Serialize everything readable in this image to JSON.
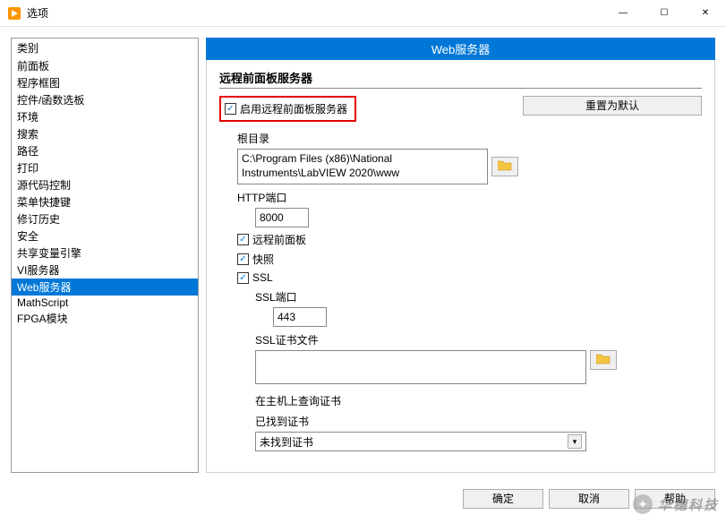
{
  "window": {
    "title": "选项",
    "minimize": "—",
    "maximize": "☐",
    "close": "✕"
  },
  "sidebar": {
    "header": "类别",
    "items": [
      {
        "label": "前面板"
      },
      {
        "label": "程序框图"
      },
      {
        "label": "控件/函数选板"
      },
      {
        "label": "环境"
      },
      {
        "label": "搜索"
      },
      {
        "label": "路径"
      },
      {
        "label": "打印"
      },
      {
        "label": "源代码控制"
      },
      {
        "label": "菜单快捷键"
      },
      {
        "label": "修订历史"
      },
      {
        "label": "安全"
      },
      {
        "label": "共享变量引擎"
      },
      {
        "label": "VI服务器"
      },
      {
        "label": "Web服务器",
        "selected": true
      },
      {
        "label": "MathScript"
      },
      {
        "label": "FPGA模块"
      }
    ]
  },
  "content": {
    "header": "Web服务器",
    "section_title": "远程前面板服务器",
    "enable_checkbox": {
      "label": "启用远程前面板服务器",
      "checked": true
    },
    "reset_button": "重置为默认",
    "root_dir": {
      "label": "根目录",
      "value": "C:\\Program Files (x86)\\National Instruments\\LabVIEW 2020\\www"
    },
    "http_port": {
      "label": "HTTP端口",
      "value": "8000"
    },
    "remote_panel": {
      "label": "远程前面板",
      "checked": true
    },
    "snapshot": {
      "label": "快照",
      "checked": true
    },
    "ssl": {
      "label": "SSL",
      "checked": true
    },
    "ssl_port": {
      "label": "SSL端口",
      "value": "443"
    },
    "ssl_cert_file": {
      "label": "SSL证书文件",
      "value": ""
    },
    "query_cert": {
      "label": "在主机上查询证书"
    },
    "found_cert": {
      "label": "已找到证书",
      "value": "未找到证书"
    }
  },
  "footer": {
    "ok": "确定",
    "cancel": "取消",
    "help": "帮助"
  },
  "watermark": {
    "text": "华穗科技"
  }
}
